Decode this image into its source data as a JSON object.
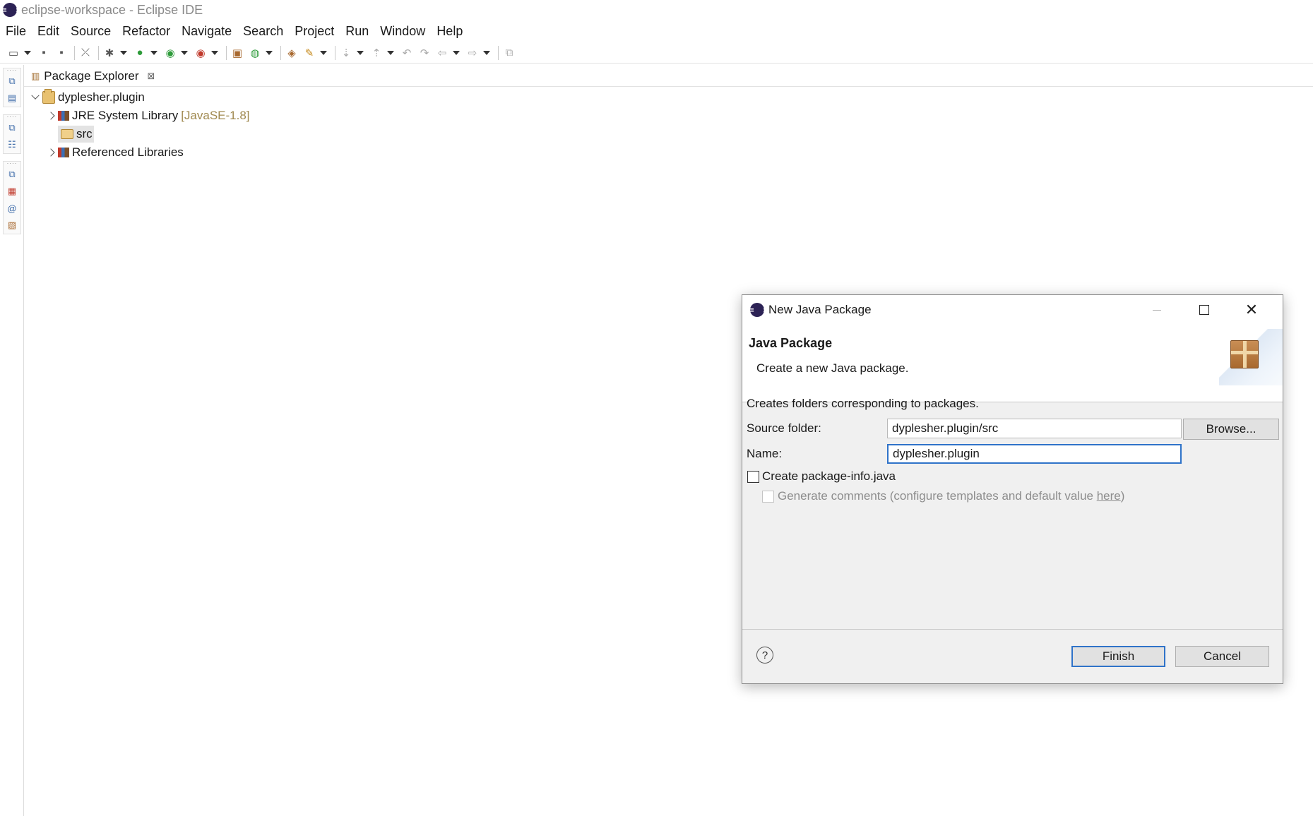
{
  "window": {
    "title": "eclipse-workspace - Eclipse IDE"
  },
  "menubar": {
    "items": [
      "File",
      "Edit",
      "Source",
      "Refactor",
      "Navigate",
      "Search",
      "Project",
      "Run",
      "Window",
      "Help"
    ]
  },
  "package_explorer": {
    "tab_label": "Package Explorer",
    "close_glyph": "⊠",
    "tree": {
      "project": {
        "label": "dyplesher.plugin",
        "expanded": true
      },
      "jre": {
        "label": "JRE System Library",
        "decoration": "[JavaSE-1.8]",
        "expanded": false
      },
      "src": {
        "label": "src",
        "selected": true
      },
      "ref_libs": {
        "label": "Referenced Libraries",
        "expanded": false
      }
    }
  },
  "dialog": {
    "title": "New Java Package",
    "close_glyph": "✕",
    "banner": {
      "title": "Java Package",
      "message": "Create a new Java package."
    },
    "description": "Creates folders corresponding to packages.",
    "source_folder": {
      "label": "Source folder:",
      "value": "dyplesher.plugin/src"
    },
    "browse_label": "Browse...",
    "name": {
      "label": "Name:",
      "value": "dyplesher.plugin"
    },
    "create_package_info": {
      "label": "Create package-info.java",
      "checked": false
    },
    "generate_comments": {
      "label": "Generate comments (configure templates and default value ",
      "link": "here",
      "suffix": ")",
      "checked": false,
      "enabled": false
    },
    "help_glyph": "?",
    "finish_label": "Finish",
    "cancel_label": "Cancel"
  },
  "colors": {
    "focus_border": "#2f73c9",
    "dialog_bg": "#f0f0f0",
    "decoration_text": "#a0894f"
  }
}
